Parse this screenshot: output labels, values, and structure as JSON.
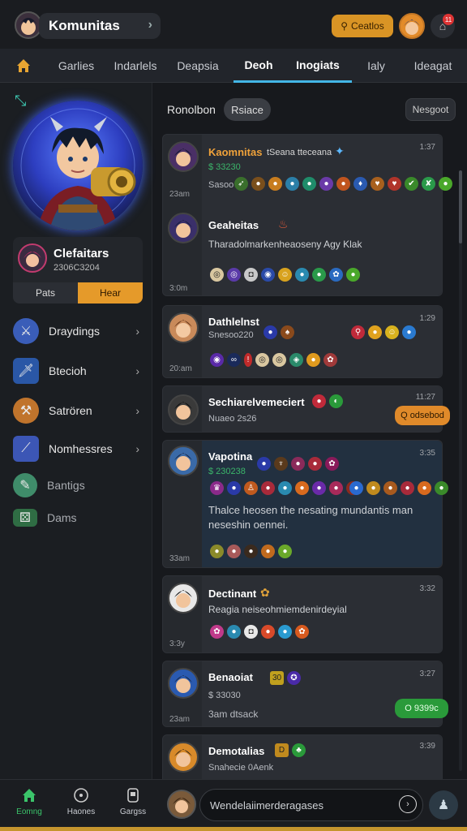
{
  "topbar": {
    "title": "Komunitas",
    "search_label": "Ceatlos",
    "notif_count": "11"
  },
  "tabs": [
    {
      "label": "Garlies",
      "active": false
    },
    {
      "label": "Indarlels",
      "active": false
    },
    {
      "label": "Deapsia",
      "active": false
    },
    {
      "label": "Deoh",
      "active": true
    },
    {
      "label": "Inogiats",
      "active": true
    },
    {
      "label": "Ialy",
      "active": false
    },
    {
      "label": "Ideagat",
      "active": false
    }
  ],
  "sidebar": {
    "profile": {
      "name": "Clefaitars",
      "subtitle": "2306C3204",
      "left_btn": "Pats",
      "right_btn": "Hear"
    },
    "items": [
      {
        "label": "Draydings",
        "icon": "swords-icon",
        "color": "#3a5db8"
      },
      {
        "label": "Btecioh",
        "icon": "sword-icon",
        "color": "#2a57a6"
      },
      {
        "label": "Satrören",
        "icon": "staff-icon",
        "color": "#c0742c"
      },
      {
        "label": "Nomhessres",
        "icon": "blade-icon",
        "color": "#3c56b5"
      },
      {
        "label": "Bantigs",
        "icon": "scroll-icon",
        "color": "#3f8c6a"
      },
      {
        "label": "Dams",
        "icon": "dice-icon",
        "color": "#2f6d44"
      }
    ]
  },
  "main": {
    "filter_label": "Ronolbon",
    "filter_chip": "Rsiace",
    "filter_right": "Nesgoot"
  },
  "posts": [
    {
      "name": "Kaomnitas",
      "name_tail": "tSeana tteceana",
      "sub": "$ 33230",
      "note": "Sasoo",
      "left": "23am",
      "time": "1:37"
    },
    {
      "name": "Geaheitas",
      "body": "Tharadolmarkenheaoseny Agy Klak",
      "left": "3:0m"
    },
    {
      "name": "Dathlelnst",
      "sub": "Snesoo220",
      "left": "20:am",
      "time": "1:29"
    },
    {
      "name": "Sechiarelvemeciert",
      "sub": "Nuaeo 2s26",
      "time": "11:27",
      "pill": "Q odsebod"
    },
    {
      "name": "Vapotina",
      "sub": "$ 230238",
      "body1": "Thalce heosen the nesating mundantis man",
      "body2": "neseshin oennei.",
      "left": "33am",
      "time": "3:35"
    },
    {
      "name": "Dectinant",
      "sub": "Reagia neiseohmiemdenirdeyial",
      "left": "3:3y",
      "time": "3:32"
    },
    {
      "name": "Benaoiat",
      "sub": "$ 33030",
      "note": "3am dtsack",
      "left": "23am",
      "time": "3:27",
      "pill": "O 9399c"
    },
    {
      "name": "Demotalias",
      "sub": "Snahecie 0Aenk",
      "time": "3:39"
    }
  ],
  "bottom": {
    "nav": [
      {
        "label": "Eomng",
        "icon": "home-icon"
      },
      {
        "label": "Haones",
        "icon": "target-icon"
      },
      {
        "label": "Gargss",
        "icon": "grid-icon"
      }
    ],
    "compose_placeholder": "Wendelaiimerderagases"
  }
}
